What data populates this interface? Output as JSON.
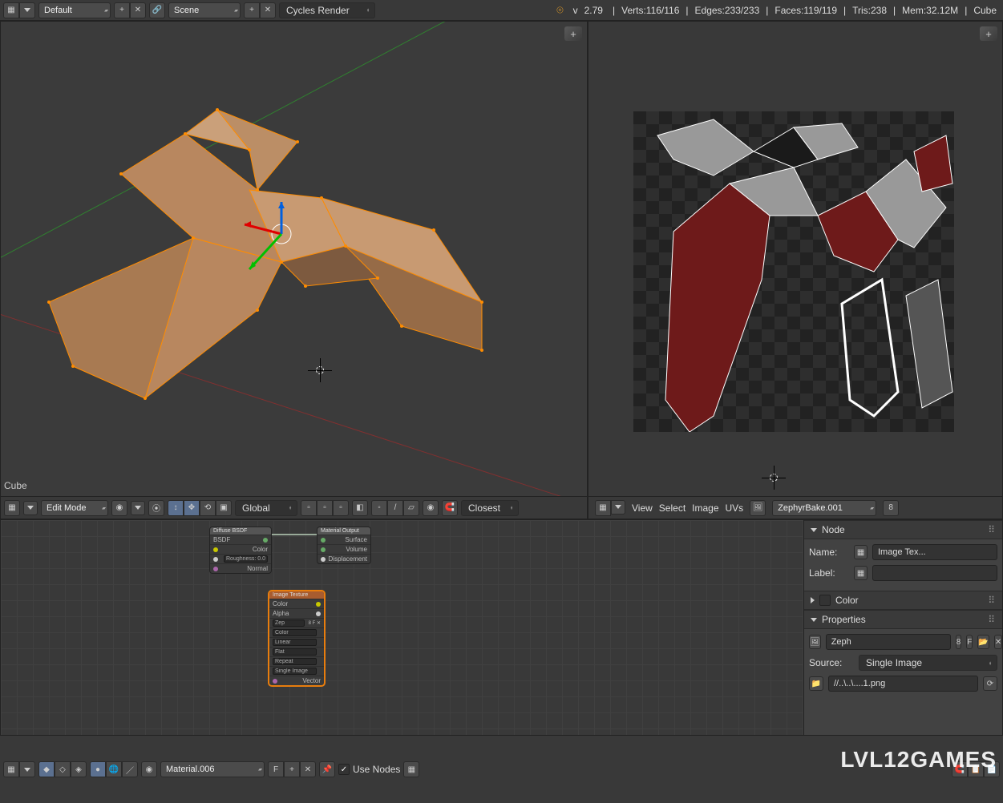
{
  "topbar": {
    "layout_label": "Default",
    "scene_label": "Scene",
    "render_engine": "Cycles Render",
    "version_prefix": "v",
    "version": "2.79",
    "stats": {
      "verts": "Verts:116/116",
      "edges": "Edges:233/233",
      "faces": "Faces:119/119",
      "tris": "Tris:238",
      "mem": "Mem:32.12M",
      "obj": "Cube"
    }
  },
  "view3d": {
    "object_name": "Cube",
    "mode": "Edit Mode",
    "orientation": "Global",
    "snap": "Closest"
  },
  "uv": {
    "menus": [
      "View",
      "Select",
      "Image",
      "UVs"
    ],
    "image_name": "ZephyrBake.001",
    "users": "8"
  },
  "node_editor": {
    "material_name": "Material.006",
    "use_nodes_label": "Use Nodes",
    "fake_user": "F",
    "nodes": {
      "diffuse": {
        "title": "Diffuse BSDF",
        "bsdf": "BSDF",
        "color": "Color",
        "rough": "Roughness: 0.000",
        "normal": "Normal"
      },
      "output": {
        "title": "Material Output",
        "surface": "Surface",
        "volume": "Volume",
        "disp": "Displacement"
      },
      "imgtex": {
        "title": "Image Texture",
        "color": "Color",
        "alpha": "Alpha",
        "img": "Zep",
        "cs": "Color",
        "interp": "Linear",
        "proj": "Flat",
        "ext": "Repeat",
        "src": "Single Image",
        "vec": "Vector"
      }
    }
  },
  "props": {
    "node_header": "Node",
    "name_label": "Name:",
    "name_value": "Image Tex...",
    "label_label": "Label:",
    "label_value": "",
    "color_header": "Color",
    "props_header": "Properties",
    "img_short": "Zeph",
    "img_users": "8",
    "fake": "F",
    "source_label": "Source:",
    "source_value": "Single Image",
    "path": "//..\\..\\....1.png"
  },
  "watermark": "LVL12GAMES"
}
